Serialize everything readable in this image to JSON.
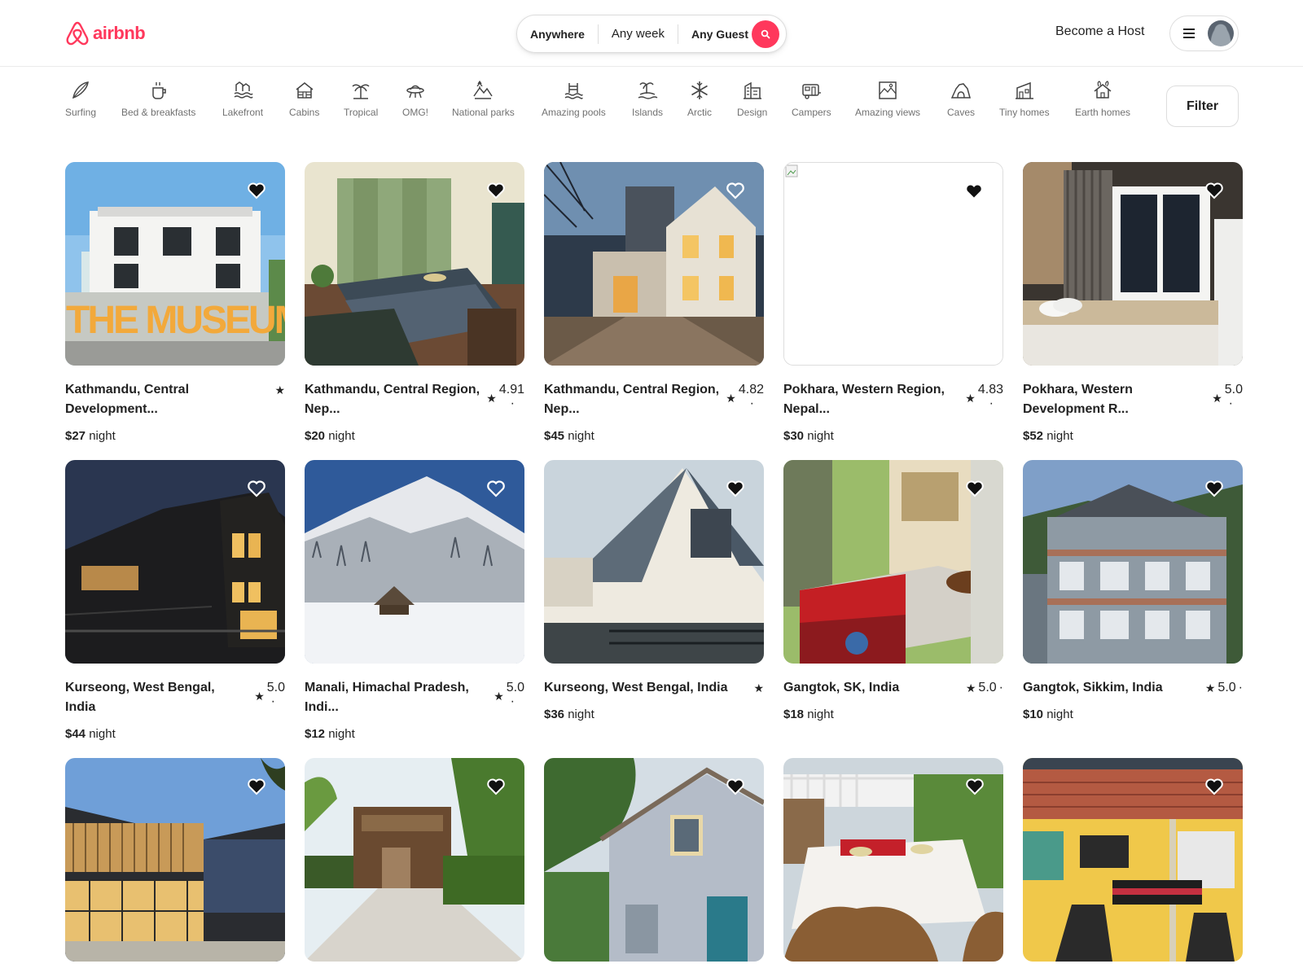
{
  "brand": {
    "name": "airbnb",
    "accent": "#ff385c"
  },
  "search": {
    "where": "Anywhere",
    "when": "Any week",
    "who": "Any Guest",
    "search_icon": "search-icon"
  },
  "header": {
    "host_link": "Become a Host",
    "menu_icon": "hamburger-icon",
    "avatar_icon": "user-avatar-icon"
  },
  "categories": [
    {
      "label": "Surfing",
      "icon": "surfboard-icon"
    },
    {
      "label": "Bed & breakfasts",
      "icon": "coffee-cup-icon"
    },
    {
      "label": "Lakefront",
      "icon": "lakefront-icon"
    },
    {
      "label": "Cabins",
      "icon": "cabin-icon"
    },
    {
      "label": "Tropical",
      "icon": "palm-tree-icon"
    },
    {
      "label": "OMG!",
      "icon": "ufo-house-icon"
    },
    {
      "label": "National parks",
      "icon": "mountain-tree-icon"
    },
    {
      "label": "Amazing pools",
      "icon": "pool-icon"
    },
    {
      "label": "Islands",
      "icon": "island-icon"
    },
    {
      "label": "Arctic",
      "icon": "snowflake-icon"
    },
    {
      "label": "Design",
      "icon": "design-building-icon"
    },
    {
      "label": "Campers",
      "icon": "camper-icon"
    },
    {
      "label": "Amazing views",
      "icon": "framed-view-icon"
    },
    {
      "label": "Caves",
      "icon": "cave-icon"
    },
    {
      "label": "Tiny homes",
      "icon": "tiny-home-icon"
    },
    {
      "label": "Earth homes",
      "icon": "earth-home-icon"
    }
  ],
  "filter": {
    "label": "Filter"
  },
  "listings": [
    {
      "location": "Kathmandu, Central Development...",
      "rating": "",
      "price": "$27",
      "unit": "night"
    },
    {
      "location": "Kathmandu, Central Region, Nep...",
      "rating": "4.91",
      "price": "$20",
      "unit": "night"
    },
    {
      "location": "Kathmandu, Central Region, Nep...",
      "rating": "4.82",
      "price": "$45",
      "unit": "night"
    },
    {
      "location": "Pokhara, Western Region, Nepal...",
      "rating": "4.83",
      "price": "$30",
      "unit": "night"
    },
    {
      "location": "Pokhara, Western Development R...",
      "rating": "5.0",
      "price": "$52",
      "unit": "night"
    },
    {
      "location": "Kurseong, West Bengal, India",
      "rating": "5.0",
      "price": "$44",
      "unit": "night"
    },
    {
      "location": "Manali, Himachal Pradesh, Indi...",
      "rating": "5.0",
      "price": "$12",
      "unit": "night"
    },
    {
      "location": "Kurseong, West Bengal, India",
      "rating": "",
      "price": "$36",
      "unit": "night"
    },
    {
      "location": "Gangtok, SK, India",
      "rating": "5.0",
      "price": "$18",
      "unit": "night"
    },
    {
      "location": "Gangtok, Sikkim, India",
      "rating": "5.0",
      "price": "$10",
      "unit": "night"
    }
  ],
  "misc": {
    "star": "★",
    "dot": "·",
    "museum_sign": "THE MUSEUM"
  }
}
